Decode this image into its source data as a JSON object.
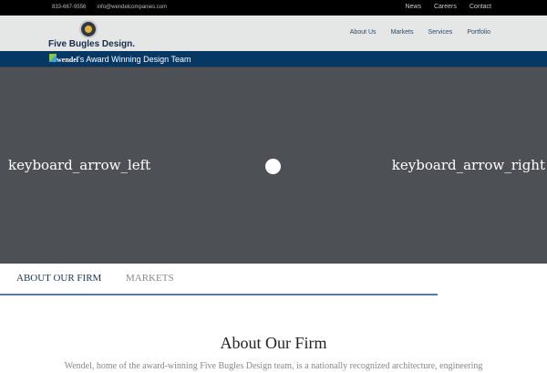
{
  "topbar": {
    "phone": "833-667-9556",
    "email": "info@wendelcompanies.com",
    "links": [
      "News",
      "Careers",
      "Contact"
    ]
  },
  "header": {
    "logo_text": "Five Bugles Design.",
    "nav": [
      "About Us",
      "Markets",
      "Services",
      "Portfolio"
    ]
  },
  "band": {
    "brand": "wendel",
    "text": "'s Award Winning Design Team"
  },
  "hero": {
    "prev": "keyboard_arrow_left",
    "next": "keyboard_arrow_right"
  },
  "tabs": [
    {
      "label": "ABOUT OUR FIRM",
      "active": true
    },
    {
      "label": "MARKETS",
      "active": false
    }
  ],
  "section": {
    "title": "About Our Firm",
    "intro": "Wendel, home of the award-winning Five Bugles Design team, is a nationally recognized architecture, engineering"
  },
  "colors": {
    "navy": "#063865",
    "tab_active": "#1a3558",
    "tab_inactive": "#888888"
  }
}
